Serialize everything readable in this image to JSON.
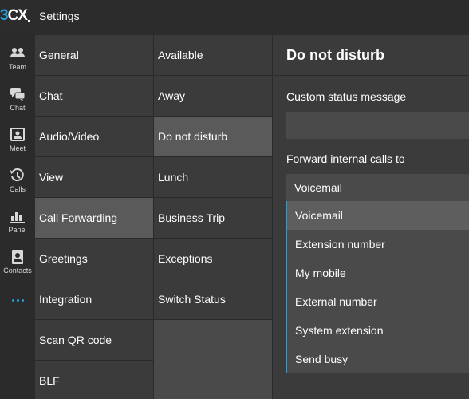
{
  "app": {
    "logo_prefix": "3",
    "logo_suffix": "CX",
    "title": "Settings"
  },
  "rail": [
    {
      "label": "Team",
      "icon": "team-icon"
    },
    {
      "label": "Chat",
      "icon": "chat-icon"
    },
    {
      "label": "Meet",
      "icon": "meet-icon"
    },
    {
      "label": "Calls",
      "icon": "calls-icon"
    },
    {
      "label": "Panel",
      "icon": "panel-icon"
    },
    {
      "label": "Contacts",
      "icon": "contacts-icon"
    }
  ],
  "settings_menu": [
    {
      "label": "General"
    },
    {
      "label": "Chat"
    },
    {
      "label": "Audio/Video"
    },
    {
      "label": "View"
    },
    {
      "label": "Call Forwarding",
      "active": true
    },
    {
      "label": "Greetings"
    },
    {
      "label": "Integration"
    },
    {
      "label": "Scan QR code"
    },
    {
      "label": "BLF"
    }
  ],
  "status_menu": [
    {
      "label": "Available"
    },
    {
      "label": "Away"
    },
    {
      "label": "Do not disturb",
      "active": true
    },
    {
      "label": "Lunch"
    },
    {
      "label": "Business Trip"
    },
    {
      "label": "Exceptions"
    },
    {
      "label": "Switch Status"
    }
  ],
  "detail": {
    "title": "Do not disturb",
    "custom_status_label": "Custom status message",
    "custom_status_value": "",
    "forward_label": "Forward internal calls to",
    "forward_value": "Voicemail",
    "options": [
      {
        "label": "Voicemail",
        "selected": true
      },
      {
        "label": "Extension number"
      },
      {
        "label": "My mobile"
      },
      {
        "label": "External number"
      },
      {
        "label": "System extension"
      },
      {
        "label": "Send busy"
      }
    ]
  },
  "colors": {
    "accent": "#1fa2df",
    "background": "#3b3b3b",
    "topbar": "#2c2c2c",
    "active_item": "#5a5a5a"
  }
}
